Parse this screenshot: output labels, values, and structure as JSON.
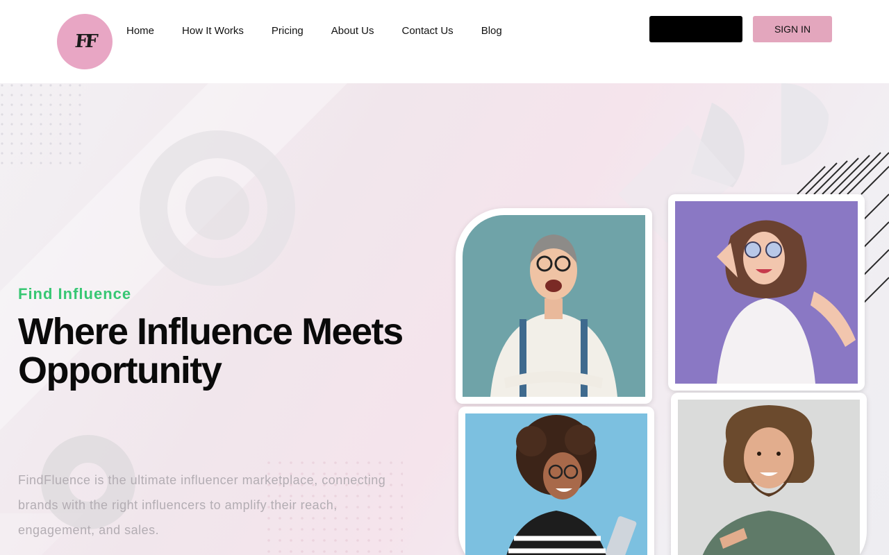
{
  "header": {
    "logo_text": "FF",
    "nav": [
      "Home",
      "How It Works",
      "Pricing",
      "About Us",
      "Contact Us",
      "Blog"
    ],
    "primary_button_label": "",
    "signin_label": "SIGN IN"
  },
  "hero": {
    "eyebrow": "Find Influence",
    "headline": "Where Influence Meets Opportunity",
    "description": "FindFluence is the ultimate influencer marketplace, connecting brands with the right influencers to amplify their reach, engagement, and sales."
  },
  "photos": [
    {
      "id": "man-glasses",
      "bg": "#6fa3a8"
    },
    {
      "id": "woman-sunglasses",
      "bg": "#8a78c4"
    },
    {
      "id": "woman-curly-hair",
      "bg": "#7cc0e0"
    },
    {
      "id": "man-beard",
      "bg": "#dadbda"
    }
  ],
  "colors": {
    "accent_green": "#37c773",
    "accent_pink": "#e3a6bd",
    "logo_pink": "#e8a6c4"
  }
}
